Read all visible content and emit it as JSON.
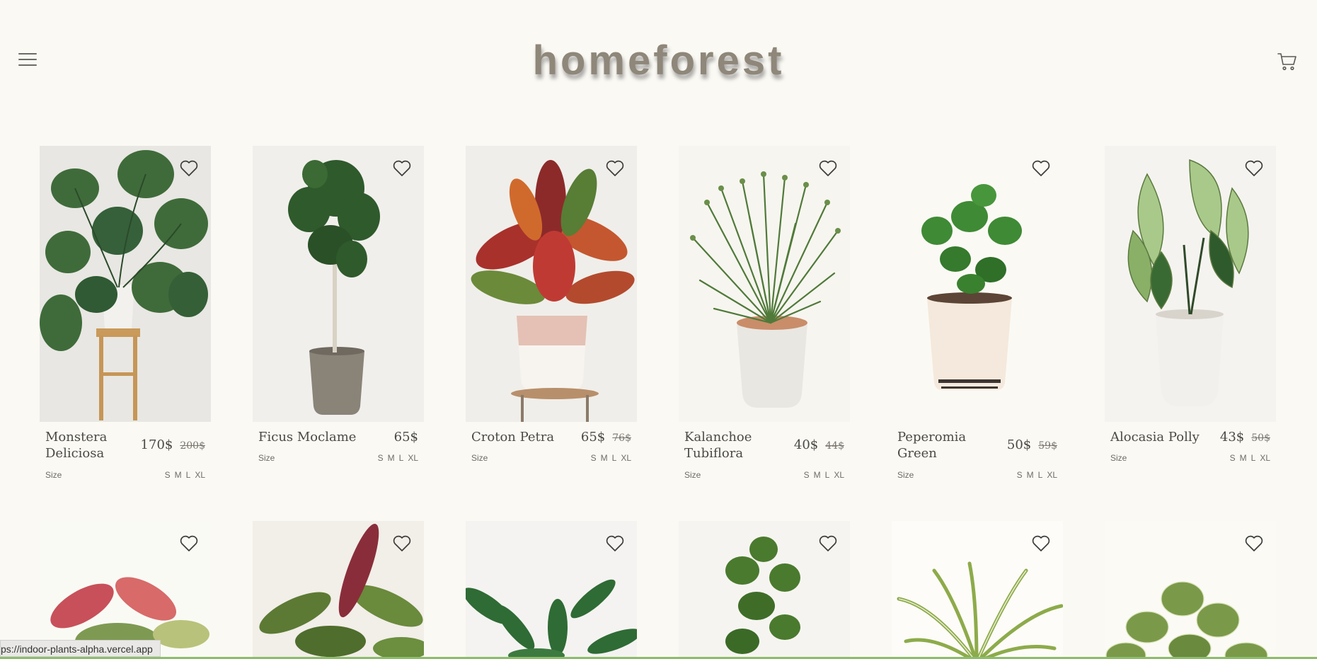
{
  "header": {
    "logo": "homeforest"
  },
  "products_row1": [
    {
      "name": "Monstera Deliciosa",
      "price": "170$",
      "old_price": "200$",
      "bg": "#e9e8e4",
      "size_label": "Size",
      "sizes": [
        "S",
        "M",
        "L",
        "XL"
      ]
    },
    {
      "name": "Ficus Moclame",
      "price": "65$",
      "old_price": "",
      "bg": "#f1efec",
      "size_label": "Size",
      "sizes": [
        "S",
        "M",
        "L",
        "XL"
      ]
    },
    {
      "name": "Croton Petra",
      "price": "65$",
      "old_price": "76$",
      "bg": "#f0eeea",
      "size_label": "Size",
      "sizes": [
        "S",
        "M",
        "L",
        "XL"
      ]
    },
    {
      "name": "Kalanchoe Tubiflora",
      "price": "40$",
      "old_price": "44$",
      "bg": "#f7f5ef",
      "size_label": "Size",
      "sizes": [
        "S",
        "M",
        "L",
        "XL"
      ]
    },
    {
      "name": "Peperomia Green",
      "price": "50$",
      "old_price": "59$",
      "bg": "#fbf9f4",
      "size_label": "Size",
      "sizes": [
        "S",
        "M",
        "L",
        "XL"
      ]
    },
    {
      "name": "Alocasia Polly",
      "price": "43$",
      "old_price": "50$",
      "bg": "#f5f3ef",
      "size_label": "Size",
      "sizes": [
        "S",
        "M",
        "L",
        "XL"
      ]
    }
  ],
  "products_row2": [
    {
      "bg": "#fafaf4"
    },
    {
      "bg": "#f2eee8"
    },
    {
      "bg": "#f4f3f1"
    },
    {
      "bg": "#f6f4f0"
    },
    {
      "bg": "#fdfcf8"
    },
    {
      "bg": "#fbfaf5"
    }
  ],
  "status_bar": {
    "url": "ps://indoor-plants-alpha.vercel.app"
  },
  "colors": {
    "background": "#fbf9f4",
    "accent_line": "#8dbd6b",
    "logo": "#8e877a"
  },
  "icons": {
    "menu": "hamburger-menu-icon",
    "cart": "shopping-cart-icon",
    "favorite": "heart-icon"
  }
}
